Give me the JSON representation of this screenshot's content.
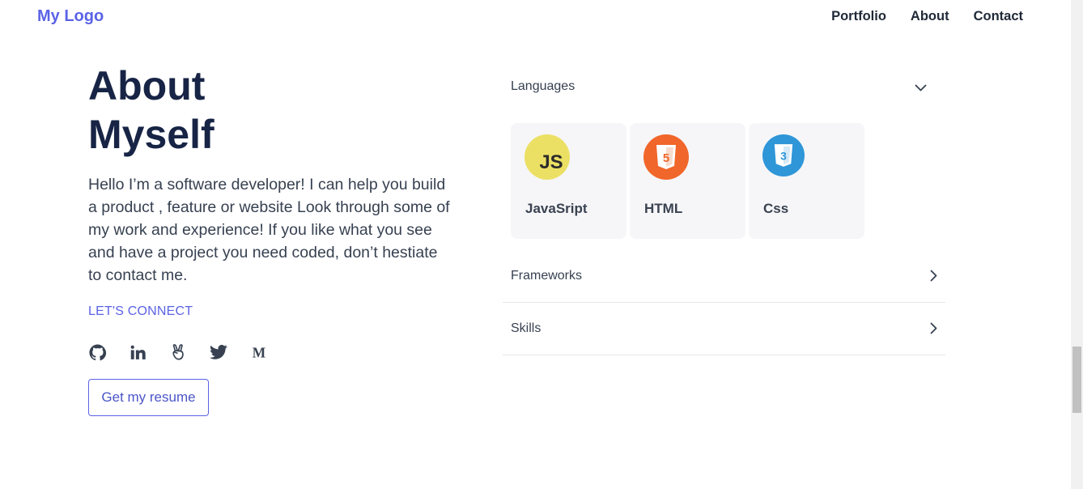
{
  "header": {
    "logo": "My Logo",
    "nav": [
      "Portfolio",
      "About",
      "Contact"
    ]
  },
  "about": {
    "title_line1": "About",
    "title_line2": "Myself",
    "intro": "Hello I’m a software developer! I can help you build a product , feature or website Look through some of my work and experience! If you like what you see and have a project you need coded, don’t hestiate to contact me.",
    "connect_label": "LET'S CONNECT",
    "socials": [
      "github-icon",
      "linkedin-icon",
      "angellist-icon",
      "twitter-icon",
      "medium-icon"
    ],
    "resume_button": "Get my resume"
  },
  "skills": {
    "sections": [
      {
        "label": "Languages",
        "state": "expanded"
      },
      {
        "label": "Frameworks",
        "state": "collapsed"
      },
      {
        "label": "Skills",
        "state": "collapsed"
      }
    ],
    "languages": [
      {
        "name": "JavaSript",
        "icon": "js-icon",
        "color": "#f0db4f",
        "badge_text": "JS"
      },
      {
        "name": "HTML",
        "icon": "html5-icon",
        "color": "#f16529",
        "badge_text": "5"
      },
      {
        "name": "Css",
        "icon": "css3-icon",
        "color": "#2d95d6",
        "badge_text": "3"
      }
    ]
  },
  "colors": {
    "accent": "#5b63e6",
    "heading": "#172445",
    "text": "#374151"
  }
}
